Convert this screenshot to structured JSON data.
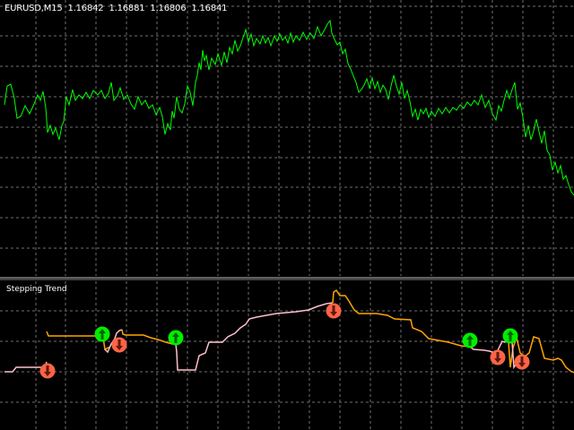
{
  "header": {
    "symbol": "EURUSD,M15",
    "open": "1.16842",
    "high": "1.16881",
    "low": "1.16806",
    "close": "1.16841"
  },
  "indicator": {
    "name": "Stepping Trend"
  },
  "colors": {
    "background": "#000000",
    "grid": "#6f6f6f",
    "price_line": "#00ff00",
    "trend_up": "#ffc0cb",
    "trend_down": "#ffa500",
    "arrow_up_bg": "#00ee00",
    "arrow_down_bg": "#ff6347",
    "separator": "#c0c0c0"
  },
  "icons": {
    "buy_signal": "arrow-up-icon",
    "sell_signal": "arrow-down-icon"
  }
}
